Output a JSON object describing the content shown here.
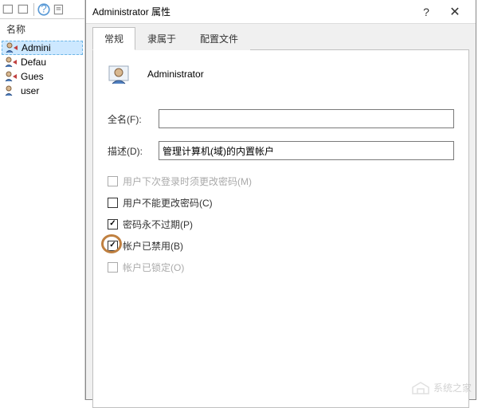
{
  "bg": {
    "header": "名称",
    "items": [
      {
        "label": "Admini"
      },
      {
        "label": "Defau"
      },
      {
        "label": "Gues"
      },
      {
        "label": "user"
      }
    ]
  },
  "dialog": {
    "title": "Administrator 属性",
    "tabs": [
      "常规",
      "隶属于",
      "配置文件"
    ],
    "username": "Administrator",
    "fields": {
      "fullname_label": "全名(F):",
      "fullname_value": "",
      "desc_label": "描述(D):",
      "desc_value": "管理计算机(域)的内置帐户"
    },
    "checks": {
      "must_change": "用户下次登录时须更改密码(M)",
      "cannot_change": "用户不能更改密码(C)",
      "never_expire": "密码永不过期(P)",
      "disabled": "帐户已禁用(B)",
      "locked": "帐户已锁定(O)"
    }
  },
  "watermark": "系统之家"
}
